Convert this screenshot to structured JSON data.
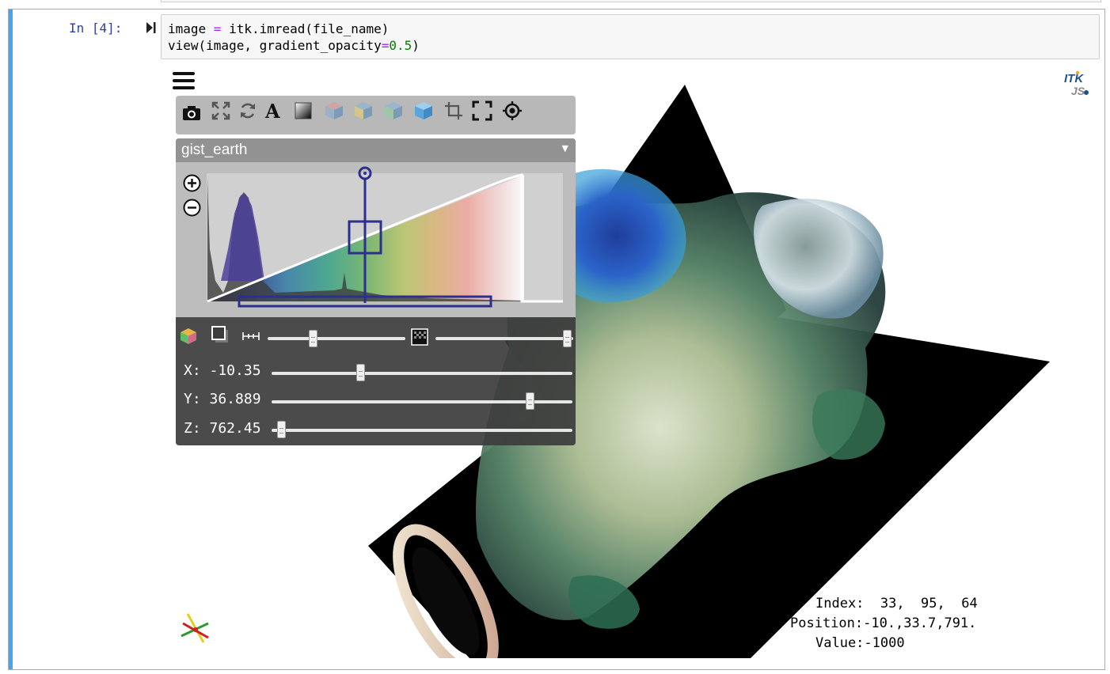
{
  "cell": {
    "prompt": "In [4]:",
    "code_line1": {
      "a": "image ",
      "op": "=",
      "b": " itk.imread(file_name)"
    },
    "code_line2": {
      "a": "view(image, gradient_opacity",
      "op": "=",
      "num": "0.5",
      "b": ")"
    }
  },
  "viewer": {
    "logo": {
      "line1": "ITK",
      "line2": "JS"
    },
    "toolbar": [
      "camera-icon",
      "fullscreen-expand-icon",
      "rotate-icon",
      "annotations-text-icon",
      "gradient-icon",
      "view-x-icon",
      "view-y-icon",
      "view-z-icon",
      "view-volume-icon",
      "crop-icon",
      "crop-frame-icon",
      "reset-crop-icon"
    ],
    "colormap": {
      "selected": "gist_earth"
    },
    "slices": {
      "x_label": "X: -10.35",
      "y_label": "Y: 36.889",
      "z_label": "Z: 762.45",
      "x_value": 0.29,
      "y_value": 0.87,
      "z_value": 0.02
    },
    "sliders": {
      "sample_distance": 0.32,
      "blend": 0.99
    },
    "info": {
      "index": "Index:  33,  95,  64",
      "position": "Position:-10.,33.7,791.",
      "value": "Value:-1000"
    },
    "colors": {
      "accent": "#42a5f5",
      "widget": "#2c2f8e"
    }
  }
}
